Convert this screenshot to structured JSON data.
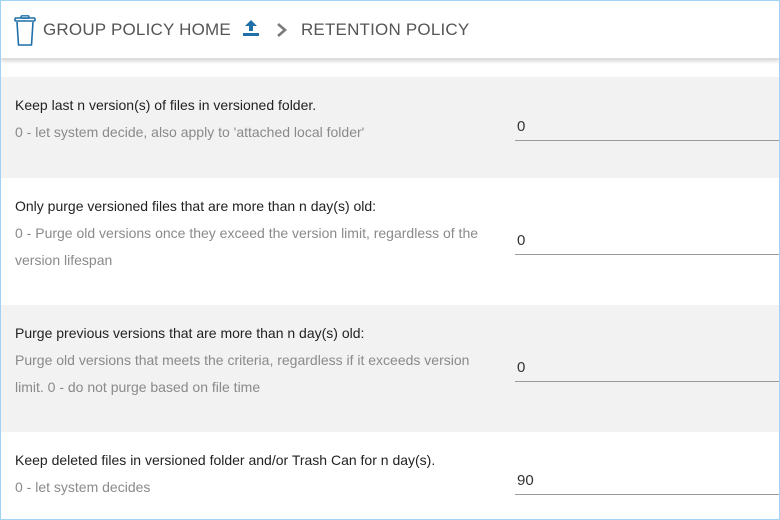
{
  "header": {
    "home_label": "GROUP POLICY HOME",
    "current_label": "RETENTION POLICY"
  },
  "settings": [
    {
      "title": "Keep last n version(s) of files in versioned folder.",
      "desc": "0 - let system decide, also apply to 'attached local folder'",
      "value": "0"
    },
    {
      "title": "Only purge versioned files that are more than n day(s) old:",
      "desc": "0 - Purge old versions once they exceed the version limit, regardless of the version lifespan",
      "value": "0"
    },
    {
      "title": "Purge previous versions that are more than n day(s) old:",
      "desc": "Purge old versions that meets the criteria, regardless if it exceeds version limit. 0 - do not purge based on file time",
      "value": "0"
    },
    {
      "title": "Keep deleted files in versioned folder and/or Trash Can for n day(s).",
      "desc": "0 - let system decides",
      "value": "90"
    }
  ],
  "colors": {
    "accent": "#1f6fa8",
    "row_alt": "#f2f2f2",
    "border": "#9fd3f3"
  }
}
